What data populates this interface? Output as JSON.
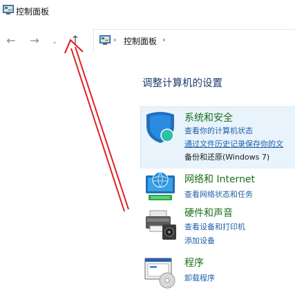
{
  "window": {
    "title": "控制面板"
  },
  "nav": {
    "back_glyph": "←",
    "forward_glyph": "→",
    "recent_glyph": "⌄",
    "up_glyph": "↑"
  },
  "address": {
    "separator": "›",
    "path": "控制面板"
  },
  "main": {
    "heading": "调整计算机的设置"
  },
  "categories": [
    {
      "title": "系统和安全",
      "links": [
        "查看你的计算机状态",
        "通过文件历史记录保存你的文",
        "备份和还原(Windows 7)"
      ]
    },
    {
      "title": "网络和 Internet",
      "links": [
        "查看网络状态和任务"
      ]
    },
    {
      "title": "硬件和声音",
      "links": [
        "查看设备和打印机",
        "添加设备"
      ]
    },
    {
      "title": "程序",
      "links": [
        "卸载程序"
      ]
    }
  ],
  "colors": {
    "heading": "#1e3a6e",
    "category_title": "#1a6e1a",
    "link": "#1f5fa8",
    "highlight": "#e8f3fc",
    "arrow": "#e02020"
  }
}
